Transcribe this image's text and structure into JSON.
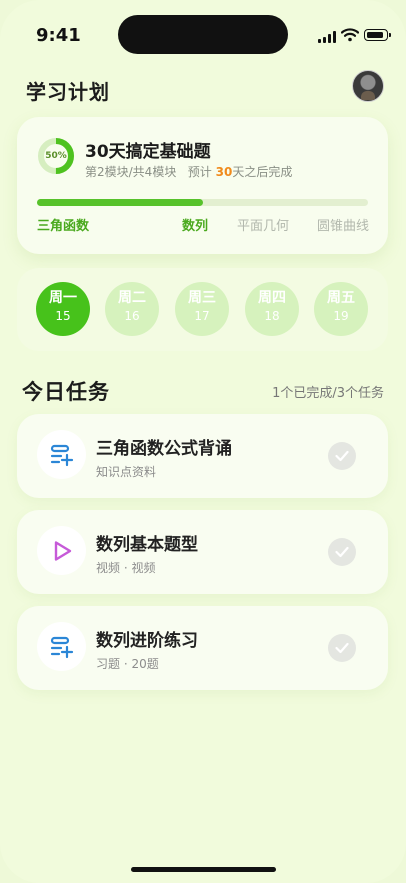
{
  "status": {
    "time": "9:41"
  },
  "header": {
    "title": "学习计划"
  },
  "plan": {
    "ring_label": "50%",
    "ring_progress": 0.5,
    "title": "30天搞定基础题",
    "sub_module": "第2模块/共4模块",
    "sub_pre": "预计",
    "sub_days": "30",
    "sub_post": "天之后完成",
    "progress": 0.5,
    "modules": [
      "三角函数",
      "数列",
      "平面几何",
      "圆锥曲线"
    ]
  },
  "week": [
    {
      "name": "周一",
      "date": "15",
      "active": true
    },
    {
      "name": "周二",
      "date": "16",
      "active": false
    },
    {
      "name": "周三",
      "date": "17",
      "active": false
    },
    {
      "name": "周四",
      "date": "18",
      "active": false
    },
    {
      "name": "周五",
      "date": "19",
      "active": false
    }
  ],
  "today": {
    "title": "今日任务",
    "count": "1个已完成/3个任务",
    "tasks": [
      {
        "name": "三角函数公式背诵",
        "meta": "知识点资料",
        "icon": "list-add-icon"
      },
      {
        "name": "数列基本题型",
        "meta": "视频 · 视频",
        "icon": "play-icon"
      },
      {
        "name": "数列进阶练习",
        "meta": "习题 · 20题",
        "icon": "list-add-icon"
      }
    ]
  },
  "colors": {
    "accent": "#47c21b",
    "highlight": "#f08a1c",
    "background": "#f1fbdc"
  }
}
